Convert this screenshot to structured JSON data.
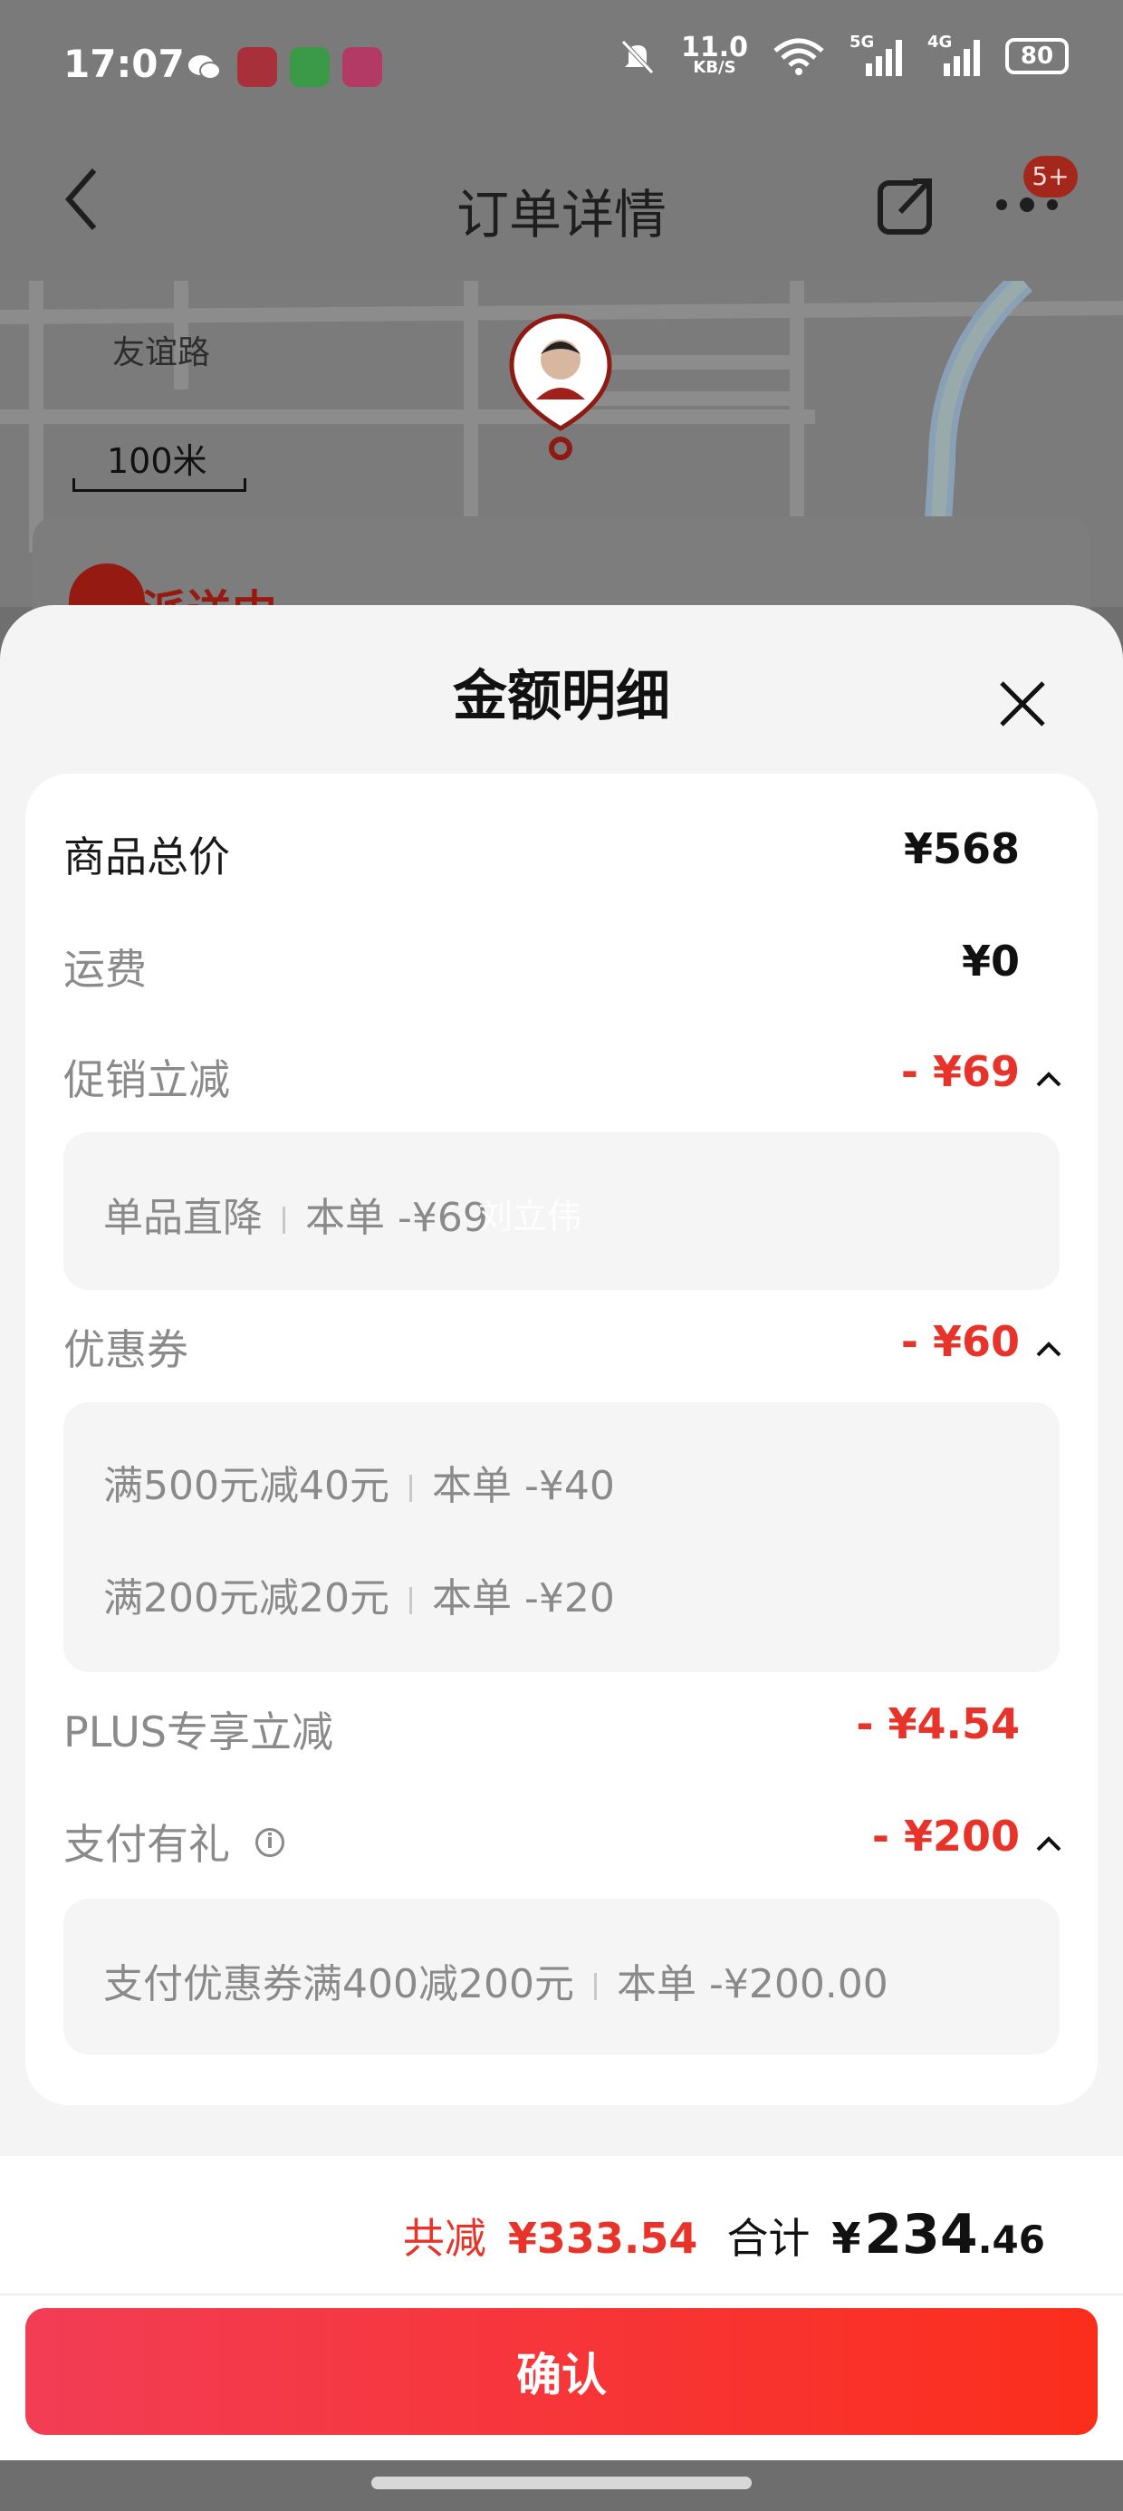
{
  "status_bar": {
    "time": "17:07",
    "net_speed": "11.0",
    "net_unit": "KB/S",
    "signal_1": "5G",
    "signal_2": "4G",
    "battery": "80"
  },
  "nav": {
    "title": "订单详情",
    "badge": "5+"
  },
  "map": {
    "road_label": "友谊路",
    "scale_label": "100米"
  },
  "order_status": {
    "text": "派送中"
  },
  "sheet": {
    "title": "金额明细",
    "rows": {
      "goods_total": {
        "label": "商品总价",
        "value": "¥568"
      },
      "shipping": {
        "label": "运费",
        "value": "¥0"
      },
      "promotion": {
        "label": "促销立减",
        "value": "- ¥69",
        "details": [
          {
            "name": "单品直降",
            "amount": "本单 -¥69"
          }
        ]
      },
      "coupon": {
        "label": "优惠券",
        "value": "- ¥60",
        "details": [
          {
            "name": "满500元减40元",
            "amount": "本单 -¥40"
          },
          {
            "name": "满200元减20元",
            "amount": "本单 -¥20"
          }
        ]
      },
      "plus": {
        "label": "PLUS专享立减",
        "value": "- ¥4.54"
      },
      "pay_gift": {
        "label": "支付有礼",
        "value": "- ¥200",
        "details": [
          {
            "name": "支付优惠券满400减200元",
            "amount": "本单 -¥200.00"
          }
        ]
      }
    },
    "watermark": "刘立伟"
  },
  "footer": {
    "saving_label": "共减",
    "saving_value": "¥333.54",
    "sum_label": "合计",
    "sum_currency": "¥",
    "sum_int": "234",
    "sum_dec": ".46",
    "confirm_label": "确认"
  },
  "colors": {
    "accent_red": "#e8332a",
    "button_gradient_start": "#f23d55",
    "button_gradient_end": "#fb2e1c"
  }
}
